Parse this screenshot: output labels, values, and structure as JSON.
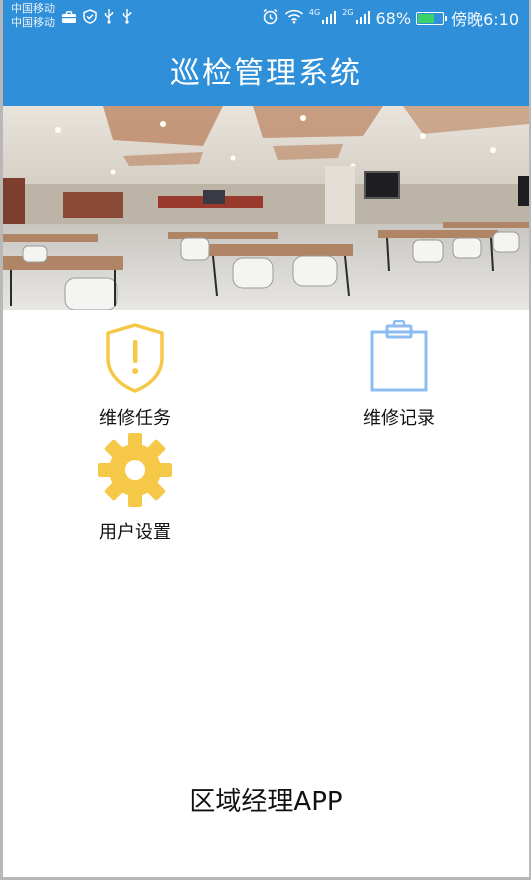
{
  "status_bar": {
    "carrier_1": "中国移动",
    "carrier_2": "中国移动",
    "net_4g": "4G",
    "net_2g": "2G",
    "battery": "68%",
    "battery_level": 0.68,
    "time": "傍晚6:10",
    "icons": [
      "briefcase-icon",
      "shield-check-icon",
      "usb-icon",
      "usb-icon",
      "alarm-icon",
      "wifi-icon",
      "signal-icon",
      "signal-icon",
      "battery-icon"
    ]
  },
  "header": {
    "title": "巡检管理系统",
    "color": "#2f8fd8"
  },
  "menu": {
    "items": [
      {
        "label": "维修任务",
        "icon": "shield-alert-icon",
        "color": "#f6c848"
      },
      {
        "label": "维修记录",
        "icon": "clipboard-icon",
        "color": "#8cbcf2"
      },
      {
        "label": "用户设置",
        "icon": "gear-icon",
        "color": "#f6c848"
      }
    ]
  },
  "footer": {
    "text": "区域经理APP"
  }
}
